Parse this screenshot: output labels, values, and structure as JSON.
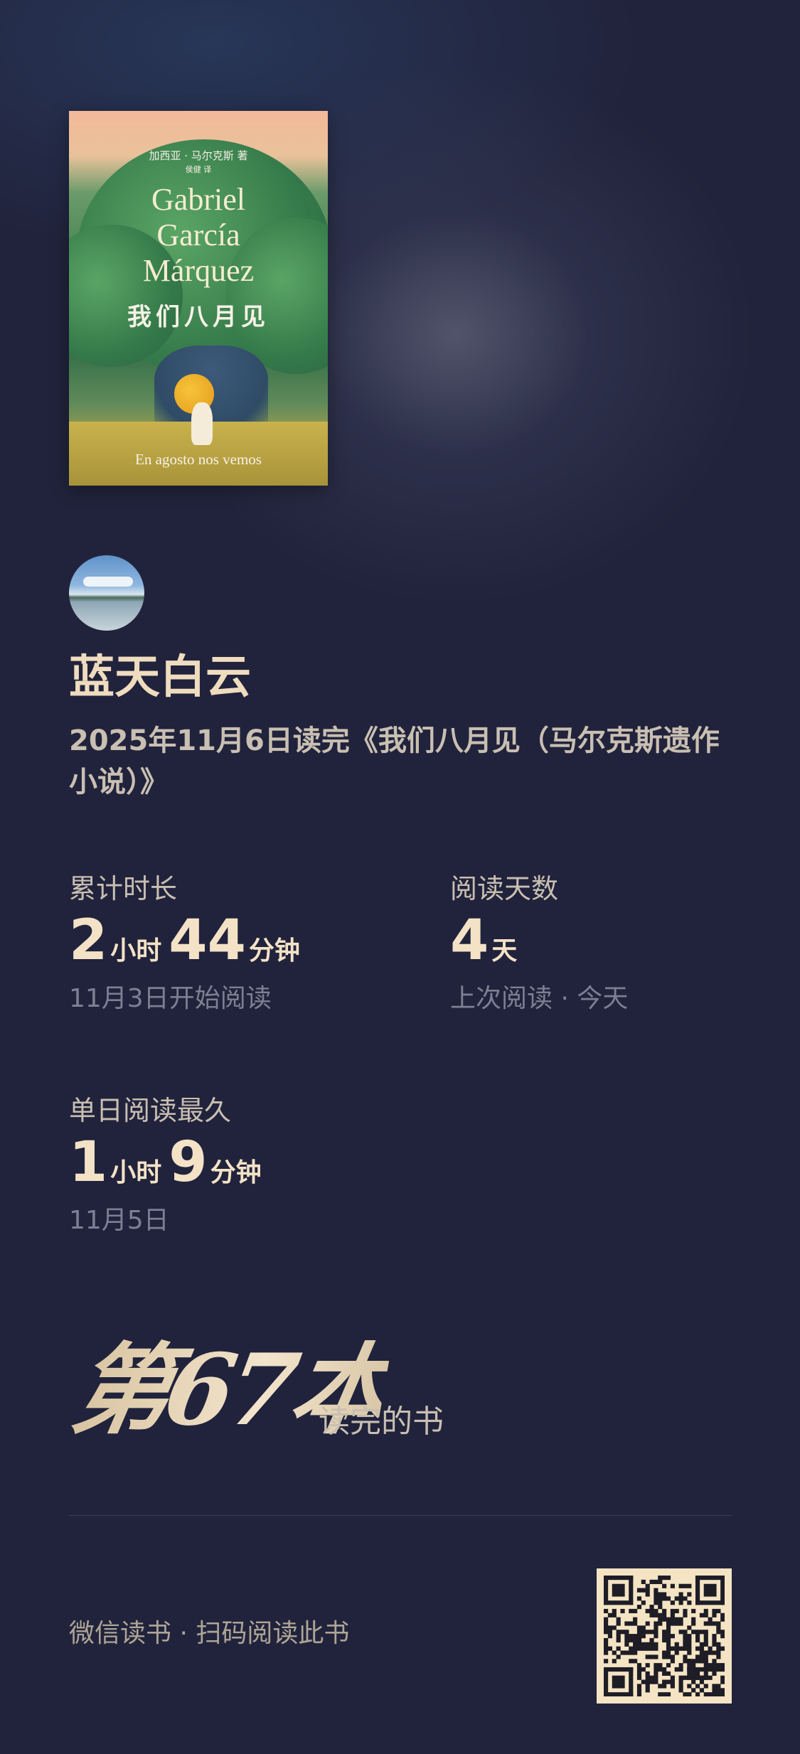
{
  "book": {
    "cover": {
      "author_cn": "加西亚 · 马尔克斯 著",
      "translator_cn": "侯健 译",
      "author_line1": "Gabriel",
      "author_line2": "García",
      "author_line3": "Márquez",
      "title_cn": "我们八月见",
      "subtitle_es": "En agosto nos vemos"
    }
  },
  "user": {
    "name": "蓝天白云"
  },
  "finish_text": "2025年11月6日读完《我们八月见（马尔克斯遗作小说）》",
  "stats": {
    "total_time": {
      "label": "累计时长",
      "hours": "2",
      "hours_unit": "小时",
      "minutes": "44",
      "minutes_unit": "分钟",
      "sub": "11月3日开始阅读"
    },
    "reading_days": {
      "label": "阅读天数",
      "days": "4",
      "days_unit": "天",
      "sub": "上次阅读 · 今天"
    },
    "longest_day": {
      "label": "单日阅读最久",
      "hours": "1",
      "hours_unit": "小时",
      "minutes": "9",
      "minutes_unit": "分钟",
      "sub": "11月5日"
    }
  },
  "rank": {
    "text": "第67本",
    "suffix": "读完的书"
  },
  "footer": {
    "text": "微信读书 · 扫码阅读此书"
  },
  "colors": {
    "background": "#21233c",
    "accent": "#f3e2c6",
    "muted": "#7e7f93"
  }
}
